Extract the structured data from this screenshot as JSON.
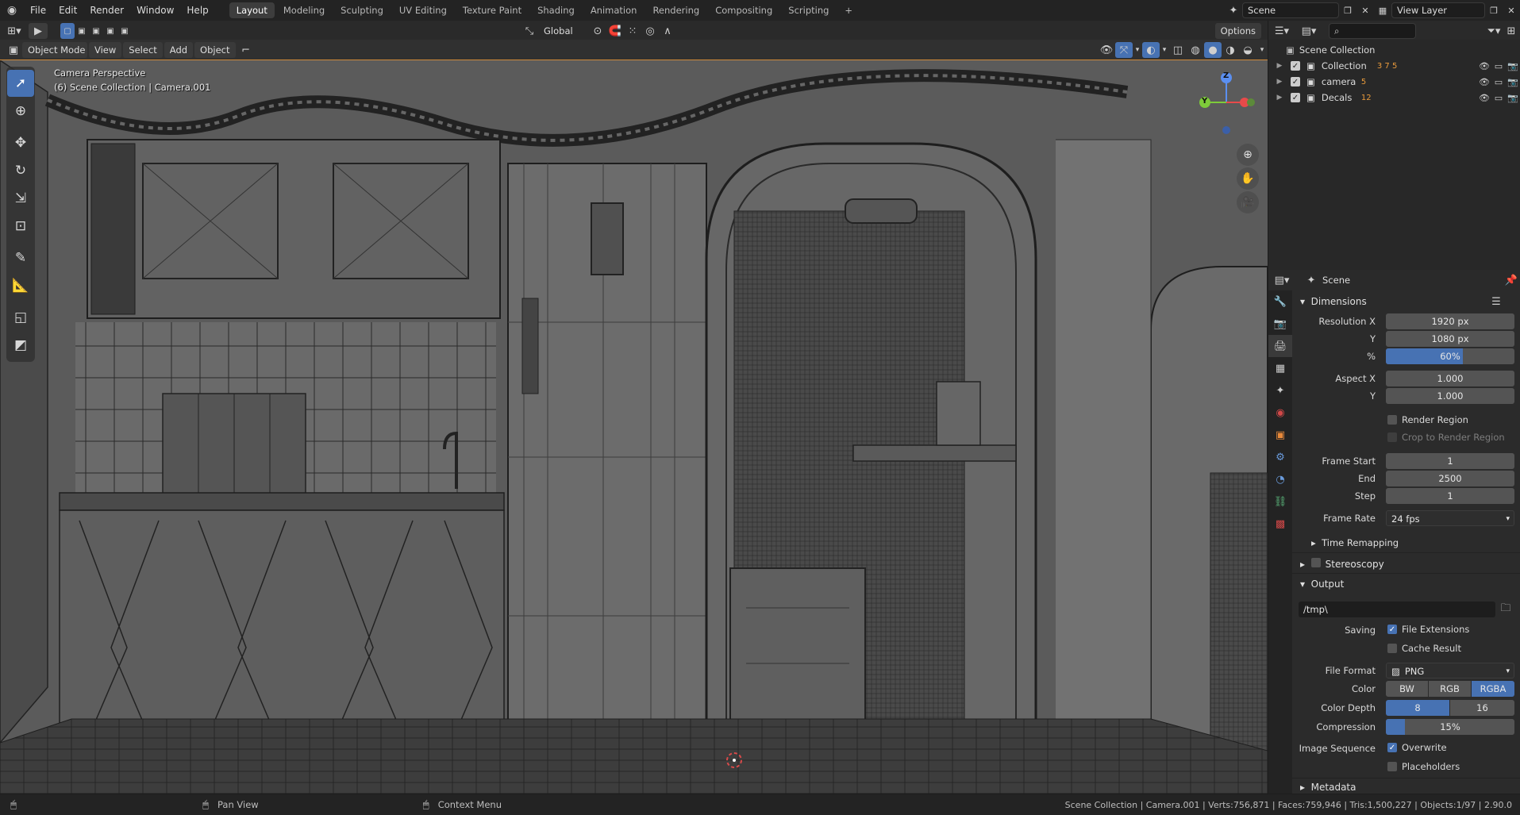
{
  "topbar": {
    "menus": [
      "File",
      "Edit",
      "Render",
      "Window",
      "Help"
    ],
    "workspaces": [
      "Layout",
      "Modeling",
      "Sculpting",
      "UV Editing",
      "Texture Paint",
      "Shading",
      "Animation",
      "Rendering",
      "Compositing",
      "Scripting"
    ],
    "active_workspace": "Layout",
    "add_workspace": "+",
    "scene_name": "Scene",
    "view_layer": "View Layer"
  },
  "header": {
    "mode": "Object Mode",
    "menus": [
      "View",
      "Select",
      "Add",
      "Object"
    ],
    "orientation": "Global",
    "options": "Options"
  },
  "viewport": {
    "camera_label": "Camera Perspective",
    "object_info": "(6) Scene Collection | Camera.001",
    "gizmo": {
      "z": "Z",
      "y": "Y"
    }
  },
  "outliner": {
    "root": "Scene Collection",
    "collections": [
      {
        "name": "Collection",
        "badge": "3  7  5"
      },
      {
        "name": "camera",
        "badge": "5"
      },
      {
        "name": "Decals",
        "badge": "12"
      }
    ]
  },
  "properties": {
    "context": "Scene",
    "dimensions": {
      "title": "Dimensions",
      "resolution_x_label": "Resolution X",
      "resolution_x": "1920 px",
      "y_label": "Y",
      "resolution_y": "1080 px",
      "percent_label": "%",
      "percent": "60%",
      "percent_fraction": 0.6,
      "aspect_x_label": "Aspect X",
      "aspect_x": "1.000",
      "aspect_y": "1.000",
      "render_region": "Render Region",
      "crop_region": "Crop to Render Region",
      "frame_start_label": "Frame Start",
      "frame_start": "1",
      "end_label": "End",
      "frame_end": "2500",
      "step_label": "Step",
      "frame_step": "1",
      "frame_rate_label": "Frame Rate",
      "frame_rate": "24 fps",
      "time_remapping": "Time Remapping"
    },
    "stereoscopy": "Stereoscopy",
    "output": {
      "title": "Output",
      "path": "/tmp\\",
      "saving_label": "Saving",
      "file_extensions": "File Extensions",
      "cache_result": "Cache Result",
      "file_format_label": "File Format",
      "file_format": "PNG",
      "color_label": "Color",
      "color_modes": [
        "BW",
        "RGB",
        "RGBA"
      ],
      "color_active": "RGBA",
      "color_depth_label": "Color Depth",
      "color_depths": [
        "8",
        "16"
      ],
      "compression_label": "Compression",
      "compression": "15%",
      "compression_fraction": 0.15,
      "image_sequence_label": "Image Sequence",
      "overwrite": "Overwrite",
      "placeholders": "Placeholders"
    },
    "metadata": "Metadata"
  },
  "statusbar": {
    "pan": "Pan View",
    "context": "Context Menu",
    "stats": "Scene Collection | Camera.001 | Verts:756,871 | Faces:759,946 | Tris:1,500,227 | Objects:1/97 | 2.90.0"
  },
  "colors": {
    "accent": "#4772b3",
    "bg": "#595959",
    "panel": "#2b2b2b"
  }
}
